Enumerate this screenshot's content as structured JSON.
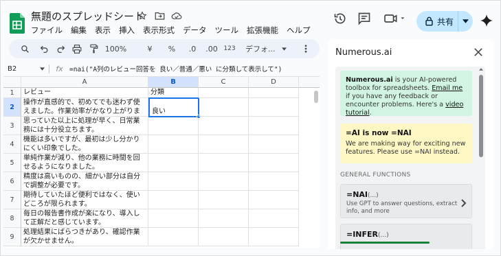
{
  "doc": {
    "title": "無題のスプレッドシート",
    "menu": [
      "ファイル",
      "編集",
      "表示",
      "挿入",
      "表示形式",
      "データ",
      "ツール",
      "拡張機能",
      "ヘルプ"
    ]
  },
  "header": {
    "share_label": "共有"
  },
  "toolbar": {
    "zoom": "100%",
    "currency": "¥",
    "percent": "%",
    "dec_decrease": ".0",
    "dec_increase": ".00",
    "number_format": "123",
    "font": "デフォ..."
  },
  "formula_bar": {
    "cell_ref": "B2",
    "fx": "fx",
    "formula": "=nai(\"A列のレビュー回答を 良い／普通／悪い に分類して表示して\")"
  },
  "sheet": {
    "columns": [
      "A",
      "B",
      "C",
      "D"
    ],
    "rows": [
      "1",
      "2",
      "3",
      "4",
      "5",
      "6",
      "7",
      "8",
      "9"
    ],
    "a": [
      "レビュー",
      "操作が直感的で、初めてでも迷わず使えました。作業効率がかなり上がります。",
      "思っていた以上に処理が早く、日常業務には十分役立ちます。",
      "機能は多いですが、最初は少し分かりにくい印象でした。",
      "単純作業が減り、他の業務に時間を回せるようになりました。",
      "精度は高いものの、細かい部分は自分で調整が必要です。",
      "期待していたほど便利ではなく、使いどころが限られます。",
      "毎日の報告書作成が楽になり、導入して正解だと感じています。",
      "処理結果にばらつきがあり、確認作業が欠かせません。"
    ],
    "b": [
      "分類",
      "良い",
      "",
      "",
      "",
      "",
      "",
      "",
      ""
    ]
  },
  "panel": {
    "title": "Numerous.ai",
    "intro": {
      "brand": "Numerous.ai",
      "text1": " is your AI-powered toolbox for spreadsheets. ",
      "email_link": "Email me",
      "text2": " if you have any feedback or encounter problems. Here's a ",
      "tutorial_link": "video tutorial",
      "text3": "."
    },
    "notice": {
      "title": "=AI is now =NAI",
      "text": "We are making way for exciting new features. Please use =NAI instead."
    },
    "section_title": "GENERAL FUNCTIONS",
    "functions": [
      {
        "name": "=NAI",
        "args": "(...)",
        "desc": "Use GPT to answer questions, extract info, and more"
      },
      {
        "name": "=INFER",
        "args": "(...)",
        "desc": ""
      }
    ]
  },
  "colors": {
    "accent": "#1a73e8",
    "share_bg": "#c2e7ff",
    "green_card": "#d1f5e2",
    "yellow_card": "#fff8c4",
    "sheets_green": "#188038"
  }
}
